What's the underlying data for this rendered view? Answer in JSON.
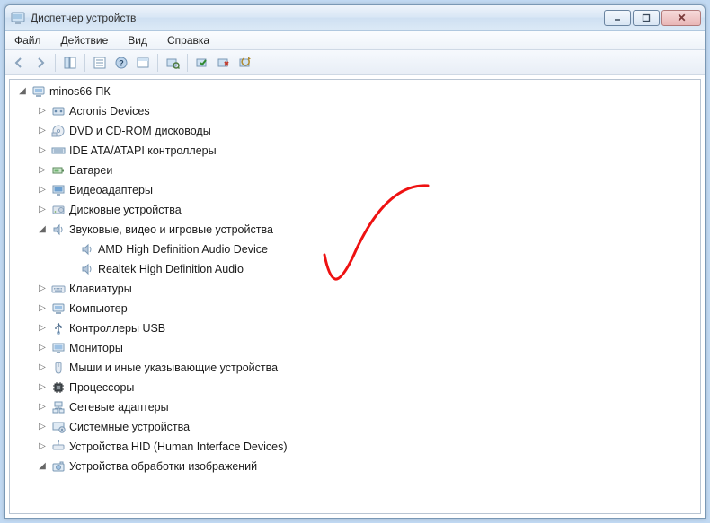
{
  "window": {
    "title": "Диспетчер устройств"
  },
  "menu": {
    "file": "Файл",
    "action": "Действие",
    "view": "Вид",
    "help": "Справка"
  },
  "tree": {
    "root": "minos66-ПК",
    "items": [
      {
        "label": "Acronis Devices",
        "icon": "generic",
        "state": "collapsed"
      },
      {
        "label": "DVD и CD-ROM дисководы",
        "icon": "disc",
        "state": "collapsed"
      },
      {
        "label": "IDE ATA/ATAPI контроллеры",
        "icon": "ide",
        "state": "collapsed"
      },
      {
        "label": "Батареи",
        "icon": "battery",
        "state": "collapsed"
      },
      {
        "label": "Видеоадаптеры",
        "icon": "display",
        "state": "collapsed"
      },
      {
        "label": "Дисковые устройства",
        "icon": "hdd",
        "state": "collapsed"
      },
      {
        "label": "Звуковые, видео и игровые устройства",
        "icon": "audio",
        "state": "expanded",
        "children": [
          {
            "label": "AMD High Definition Audio Device",
            "icon": "audio"
          },
          {
            "label": "Realtek High Definition Audio",
            "icon": "audio"
          }
        ]
      },
      {
        "label": "Клавиатуры",
        "icon": "keyboard",
        "state": "collapsed"
      },
      {
        "label": "Компьютер",
        "icon": "computer",
        "state": "collapsed"
      },
      {
        "label": "Контроллеры USB",
        "icon": "usb",
        "state": "collapsed"
      },
      {
        "label": "Мониторы",
        "icon": "monitor",
        "state": "collapsed"
      },
      {
        "label": "Мыши и иные указывающие устройства",
        "icon": "mouse",
        "state": "collapsed"
      },
      {
        "label": "Процессоры",
        "icon": "cpu",
        "state": "collapsed"
      },
      {
        "label": "Сетевые адаптеры",
        "icon": "network",
        "state": "collapsed"
      },
      {
        "label": "Системные устройства",
        "icon": "system",
        "state": "collapsed"
      },
      {
        "label": "Устройства HID (Human Interface Devices)",
        "icon": "hid",
        "state": "collapsed"
      },
      {
        "label": "Устройства обработки изображений",
        "icon": "imaging",
        "state": "expanded"
      }
    ]
  }
}
